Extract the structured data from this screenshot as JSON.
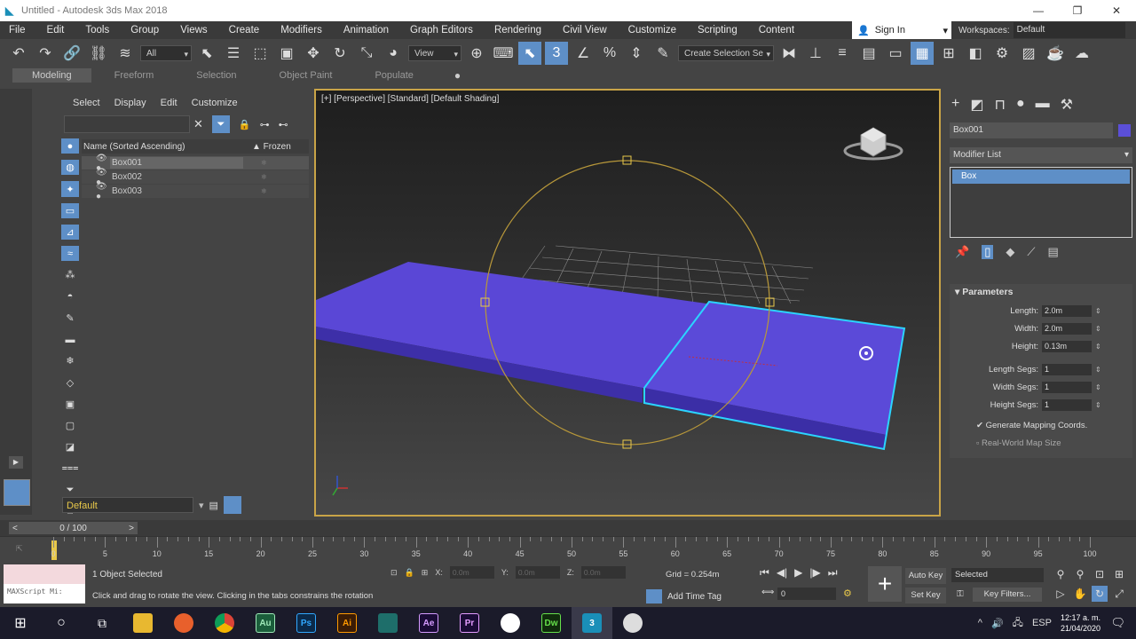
{
  "window": {
    "title": "Untitled - Autodesk 3ds Max 2018",
    "minimize": "—",
    "maximize": "❐",
    "close": "✕"
  },
  "menu": [
    "File",
    "Edit",
    "Tools",
    "Group",
    "Views",
    "Create",
    "Modifiers",
    "Animation",
    "Graph Editors",
    "Rendering",
    "Civil View",
    "Customize",
    "Scripting",
    "Content"
  ],
  "signin": {
    "label": "Sign In"
  },
  "workspaces": {
    "label": "Workspaces:",
    "value": "Default"
  },
  "toolbar": {
    "filter": "All",
    "refcoord": "View",
    "named_selection": "Create Selection Se"
  },
  "ribbon": {
    "tabs": [
      "Modeling",
      "Freeform",
      "Selection",
      "Object Paint",
      "Populate"
    ]
  },
  "scene_explorer": {
    "menu": [
      "Select",
      "Display",
      "Edit",
      "Customize"
    ],
    "header_name": "Name (Sorted Ascending)",
    "header_frozen": "▲ Frozen",
    "objects": [
      "Box001",
      "Box002",
      "Box003"
    ],
    "layer": "Default"
  },
  "viewport": {
    "label": "[+] [Perspective] [Standard] [Default Shading]"
  },
  "command_panel": {
    "object_name": "Box001",
    "object_color": "#5b4fd8",
    "modifier_list": "Modifier List",
    "stack_item": "Box",
    "params_title": "Parameters",
    "length_label": "Length:",
    "length": "2.0m",
    "width_label": "Width:",
    "width": "2.0m",
    "height_label": "Height:",
    "height": "0.13m",
    "lsegs_label": "Length Segs:",
    "lsegs": "1",
    "wsegs_label": "Width Segs:",
    "wsegs": "1",
    "hsegs_label": "Height Segs:",
    "hsegs": "1",
    "gen_mapping": "Generate Mapping Coords.",
    "real_world": "Real-World Map Size"
  },
  "timeline": {
    "slider": "0 / 100",
    "ticks": [
      "0",
      "5",
      "10",
      "15",
      "20",
      "25",
      "30",
      "35",
      "40",
      "45",
      "50",
      "55",
      "60",
      "65",
      "70",
      "75",
      "80",
      "85",
      "90",
      "95",
      "100"
    ]
  },
  "status": {
    "maxscript": "MAXScript Mi:",
    "selected": "1 Object Selected",
    "prompt": "Click and drag to rotate the view.  Clicking in the tabs constrains the rotation",
    "x_label": "X:",
    "x": "0.0m",
    "y_label": "Y:",
    "y": "0.0m",
    "z_label": "Z:",
    "z": "0.0m",
    "grid": "Grid = 0.254m",
    "add_time_tag": "Add Time Tag",
    "frame": "0",
    "auto_key": "Auto Key",
    "set_key": "Set Key",
    "selected_filter": "Selected",
    "key_filters": "Key Filters..."
  },
  "taskbar": {
    "apps": [
      {
        "name": "Au",
        "color": "#1b5e3b",
        "fg": "#9fe8b8"
      },
      {
        "name": "Ps",
        "color": "#0b2a4a",
        "fg": "#31a8ff"
      },
      {
        "name": "Ai",
        "color": "#3a1c06",
        "fg": "#ff9a00"
      },
      {
        "name": "Ae",
        "color": "#1a0b36",
        "fg": "#d59bff"
      },
      {
        "name": "Pr",
        "color": "#1a0b36",
        "fg": "#e49bff"
      },
      {
        "name": "Dw",
        "color": "#102c0c",
        "fg": "#66e04b"
      }
    ],
    "time": "12:17 a. m.",
    "date": "21/04/2020",
    "lang": "ESP"
  }
}
